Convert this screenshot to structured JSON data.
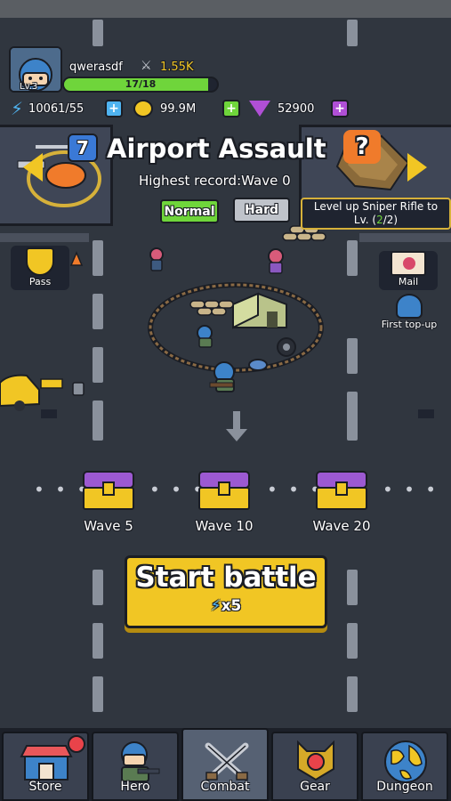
{
  "player": {
    "name": "qwerasdf",
    "level": "Lv.3",
    "power": "1.55K",
    "xp_text": "17/18",
    "xp_fraction": 0.94
  },
  "resources": {
    "energy": "10061/55",
    "coins": "99.9M",
    "gems": "52900"
  },
  "level": {
    "number": "7",
    "title": "Airport Assault",
    "record": "Highest record:Wave 0",
    "normal_label": "Normal",
    "hard_label": "Hard",
    "unlock_line1": "Level up Sniper Rifle to",
    "unlock_prefix": "Lv. (",
    "unlock_progress": "2",
    "unlock_suffix": "/2)",
    "locked_mark": "?"
  },
  "side_buttons": {
    "pass_label": "Pass",
    "mail_label": "Mail",
    "first_topup_label": "First top-up"
  },
  "rewards": [
    {
      "label": "Wave 5"
    },
    {
      "label": "Wave 10"
    },
    {
      "label": "Wave 20"
    }
  ],
  "start": {
    "label": "Start battle",
    "cost": "x5"
  },
  "nav": {
    "store": "Store",
    "hero": "Hero",
    "combat": "Combat",
    "gear": "Gear",
    "dungeon": "Dungeon"
  },
  "colors": {
    "accent_green": "#6fd53b",
    "start_yellow": "#f1c624",
    "energy_blue": "#3a79d6",
    "gem_purple": "#b04fd6"
  }
}
